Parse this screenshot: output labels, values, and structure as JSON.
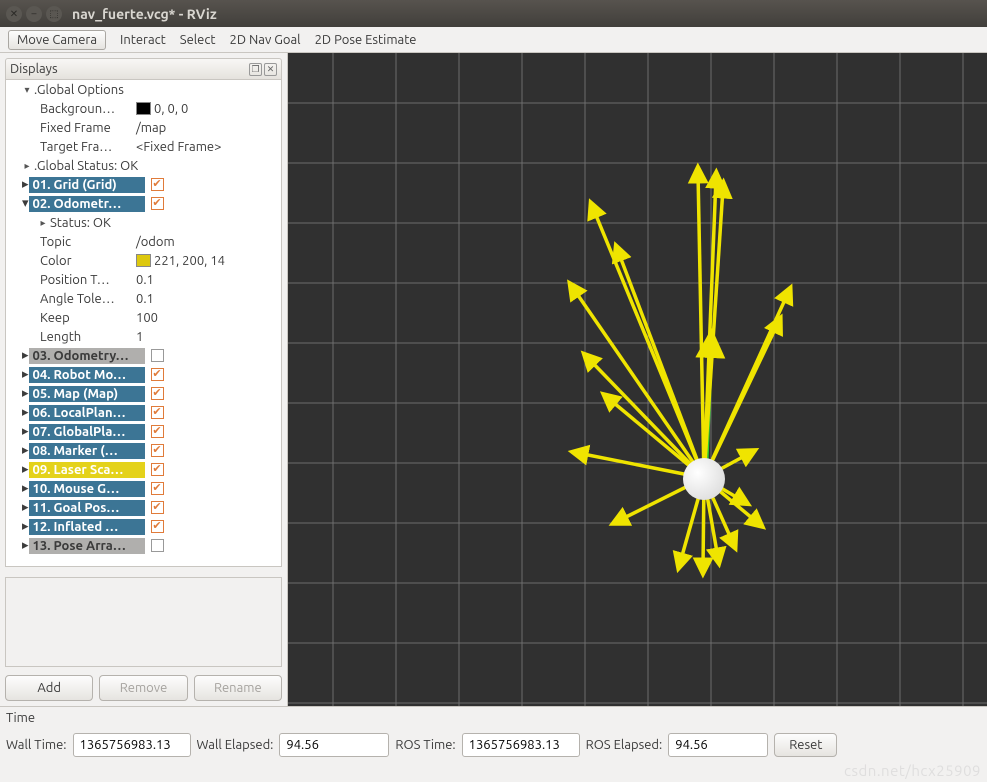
{
  "window": {
    "title": "nav_fuerte.vcg* - RViz"
  },
  "toolbar": {
    "move_camera": "Move Camera",
    "interact": "Interact",
    "select": "Select",
    "nav_goal": "2D Nav Goal",
    "pose_estimate": "2D Pose Estimate"
  },
  "displays": {
    "title": "Displays",
    "global_options": {
      "label": ".Global Options",
      "background": {
        "key": "Backgroun…",
        "value": "0, 0, 0",
        "swatch": "#000000"
      },
      "fixed_frame": {
        "key": "Fixed Frame",
        "value": "/map"
      },
      "target_frame": {
        "key": "Target Fra…",
        "value": "<Fixed Frame>"
      }
    },
    "global_status": {
      "label": ".Global Status: OK"
    },
    "items": [
      {
        "label": "01. Grid (Grid)",
        "checked": true,
        "style": "blue"
      },
      {
        "label": "02. Odometr…",
        "checked": true,
        "style": "blue",
        "expanded": true,
        "status": "Status: OK",
        "props": [
          {
            "key": "Topic",
            "value": "/odom"
          },
          {
            "key": "Color",
            "value": "221, 200, 14",
            "swatch": "#ddc80e"
          },
          {
            "key": "Position T…",
            "value": "0.1"
          },
          {
            "key": "Angle Tole…",
            "value": "0.1"
          },
          {
            "key": "Keep",
            "value": "100"
          },
          {
            "key": "Length",
            "value": "1"
          }
        ]
      },
      {
        "label": "03. Odometry…",
        "checked": false,
        "style": "grey"
      },
      {
        "label": "04. Robot Mo…",
        "checked": true,
        "style": "blue"
      },
      {
        "label": "05. Map (Map)",
        "checked": true,
        "style": "blue"
      },
      {
        "label": "06. LocalPlan…",
        "checked": true,
        "style": "blue"
      },
      {
        "label": "07. GlobalPla…",
        "checked": true,
        "style": "blue"
      },
      {
        "label": "08. Marker (…",
        "checked": true,
        "style": "blue"
      },
      {
        "label": "09. Laser Sca…",
        "checked": true,
        "style": "yellow"
      },
      {
        "label": "10. Mouse G…",
        "checked": true,
        "style": "blue"
      },
      {
        "label": "11. Goal Pos…",
        "checked": true,
        "style": "blue"
      },
      {
        "label": "12. Inflated …",
        "checked": true,
        "style": "blue"
      },
      {
        "label": "13. Pose Arra…",
        "checked": false,
        "style": "grey"
      }
    ],
    "buttons": {
      "add": "Add",
      "remove": "Remove",
      "rename": "Rename"
    }
  },
  "time": {
    "title": "Time",
    "wall_time": {
      "label": "Wall Time:",
      "value": "1365756983.13"
    },
    "wall_elapsed": {
      "label": "Wall Elapsed:",
      "value": "94.56"
    },
    "ros_time": {
      "label": "ROS Time:",
      "value": "1365756983.13"
    },
    "ros_elapsed": {
      "label": "ROS Elapsed:",
      "value": "94.56"
    },
    "reset": "Reset"
  },
  "watermark": "csdn.net/hcx25909"
}
